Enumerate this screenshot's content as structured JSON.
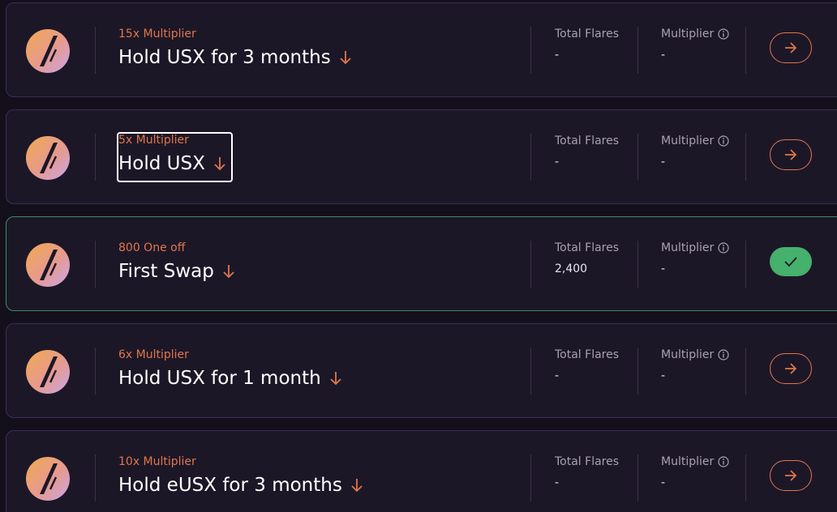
{
  "tasks": [
    {
      "subtitle": "15x Multiplier",
      "title": "Hold USX for 3 months",
      "stat1_label": "Total Flares",
      "stat1_value": "-",
      "stat2_label": "Multiplier",
      "stat2_value": "-",
      "status": "pending",
      "icon": "arrow-right-icon"
    },
    {
      "subtitle": "5x Multiplier",
      "title": "Hold USX",
      "stat1_label": "Total Flares",
      "stat1_value": "-",
      "stat2_label": "Multiplier",
      "stat2_value": "-",
      "status": "pending",
      "icon": "arrow-right-icon"
    },
    {
      "subtitle": "800 One off",
      "title": "First Swap",
      "stat1_label": "Total Flares",
      "stat1_value": "2,400",
      "stat2_label": "Multiplier",
      "stat2_value": "-",
      "status": "completed",
      "icon": "checkmark-icon"
    },
    {
      "subtitle": "6x Multiplier",
      "title": "Hold USX for 1 month",
      "stat1_label": "Total Flares",
      "stat1_value": "-",
      "stat2_label": "Multiplier",
      "stat2_value": "-",
      "status": "pending",
      "icon": "arrow-right-icon"
    },
    {
      "subtitle": "10x Multiplier",
      "title": "Hold eUSX for 3 months",
      "stat1_label": "Total Flares",
      "stat1_value": "-",
      "stat2_label": "Multiplier",
      "stat2_value": "-",
      "status": "pending",
      "icon": "arrow-right-icon"
    }
  ],
  "colors": {
    "accent": "#e0764a",
    "success": "#46b06d",
    "card_border": "#3b2d52",
    "completed_border": "#3f8a63",
    "background": "#13101c"
  }
}
